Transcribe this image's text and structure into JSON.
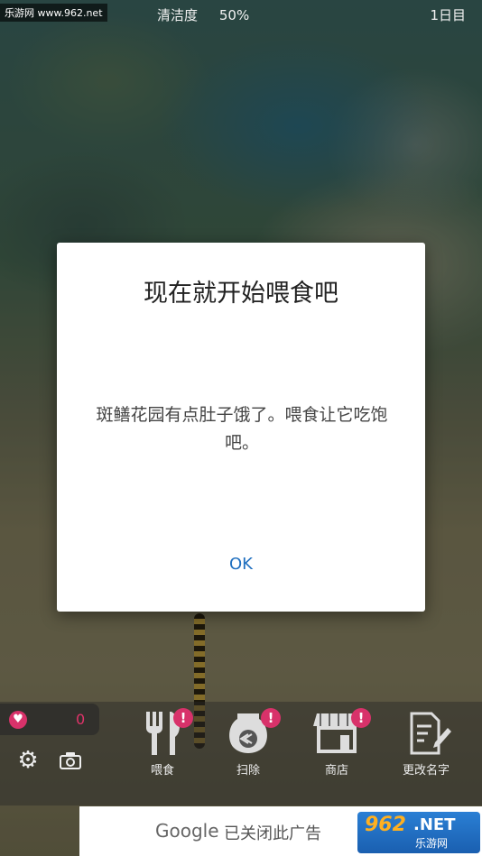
{
  "status": {
    "left_partial": "%",
    "cleanliness_label": "清洁度",
    "cleanliness_value": "50%",
    "day": "1日目"
  },
  "watermark": "乐游网 www.962.net",
  "dialog": {
    "title": "现在就开始喂食吧",
    "message": "斑鳝花园有点肚子饿了。喂食让它吃饱吧。",
    "ok_label": "OK"
  },
  "hearts": {
    "count": "0"
  },
  "toolbar": {
    "feed_label": "喂食",
    "clean_label": "扫除",
    "shop_label": "商店",
    "rename_label": "更改名字",
    "badge_text": "!"
  },
  "ad": {
    "google": "Google",
    "closed_text": "已关闭此广告"
  },
  "logo": {
    "big": "962",
    "net": ".NET",
    "cn": "乐游网"
  },
  "colors": {
    "accent": "#d8326a",
    "ok_blue": "#1f6fbf"
  }
}
